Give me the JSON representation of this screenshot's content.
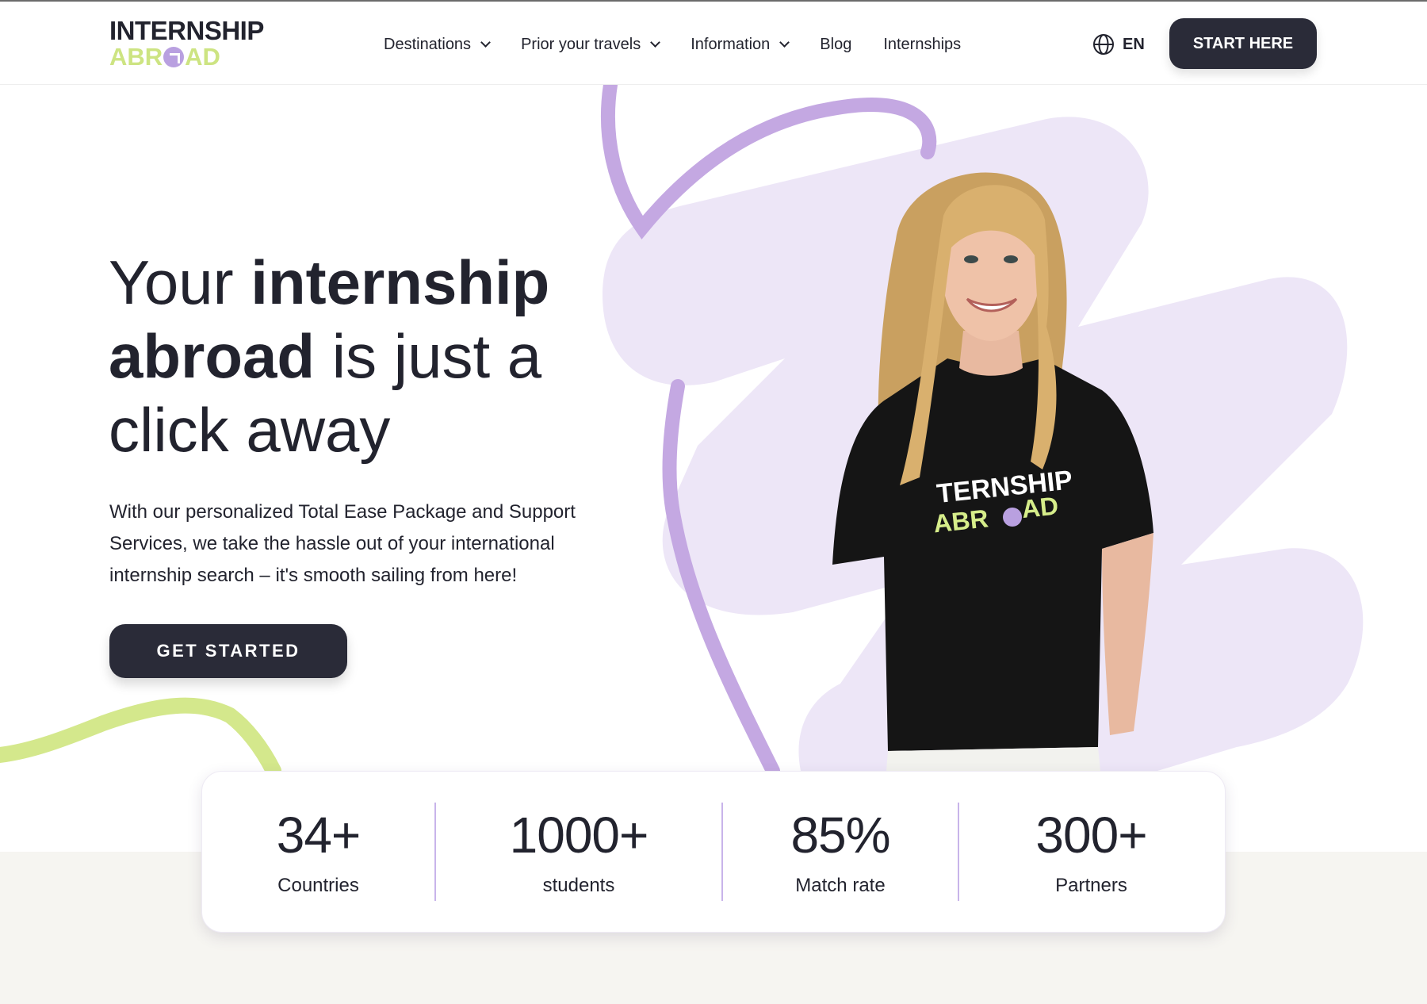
{
  "brand": {
    "logo_top": "INTERNSHIP",
    "logo_bottom_left": "ABR",
    "logo_bottom_right": "AD",
    "accent_purple": "#b9a0e0",
    "accent_green": "#cde482",
    "dark": "#2a2b38"
  },
  "nav": {
    "items": [
      {
        "label": "Destinations",
        "has_dropdown": true
      },
      {
        "label": "Prior your travels",
        "has_dropdown": true
      },
      {
        "label": "Information",
        "has_dropdown": true
      },
      {
        "label": "Blog",
        "has_dropdown": false
      },
      {
        "label": "Internships",
        "has_dropdown": false
      }
    ],
    "language": "EN",
    "language_icon": "globe-icon",
    "cta": "START HERE"
  },
  "hero": {
    "title_part1": "Your ",
    "title_bold1": "internship",
    "title_bold2": "abroad",
    "title_part2": " is just a",
    "title_part3": "click away",
    "description": "With our personalized Total Ease Package and Support Services, we take the hassle out of your international internship search – it's smooth sailing from here!",
    "cta": "GET STARTED",
    "shirt_top": "TERNSHIP",
    "shirt_bottom_left": "ABR",
    "shirt_bottom_right": "AD"
  },
  "stats": [
    {
      "value": "34+",
      "label": "Countries"
    },
    {
      "value": "1000+",
      "label": "students"
    },
    {
      "value": "85%",
      "label": "Match rate"
    },
    {
      "value": "300+",
      "label": "Partners"
    }
  ]
}
